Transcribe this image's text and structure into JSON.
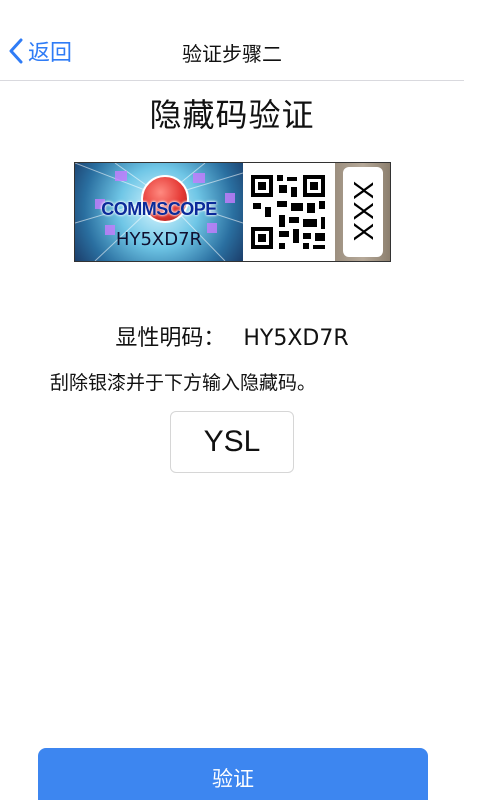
{
  "navbar": {
    "back_label": "返回",
    "title": "验证步骤二"
  },
  "page": {
    "heading": "隐藏码验证"
  },
  "label_image": {
    "brand": "COMMSCOPE",
    "serial": "HY5XD7R",
    "scratch_text": "XXX"
  },
  "verification": {
    "visible_code_label": "显性明码：",
    "visible_code_value": "HY5XD7R",
    "instruction": "刮除银漆并于下方输入隐藏码。",
    "hidden_code_value": "YSL"
  },
  "actions": {
    "verify_label": "验证"
  },
  "colors": {
    "accent": "#2f7cf6",
    "button": "#3d86f0"
  }
}
